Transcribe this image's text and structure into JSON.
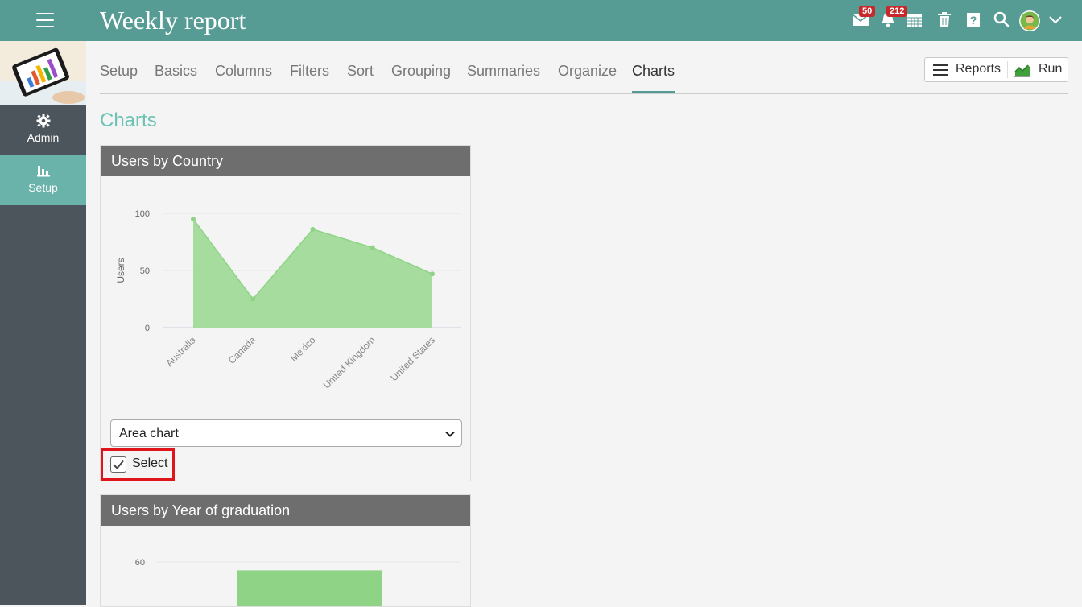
{
  "header": {
    "title": "Weekly report",
    "messages_badge": "50",
    "notifications_badge": "212"
  },
  "sidebar": {
    "items": [
      {
        "label": "Admin",
        "icon": "gear-icon"
      },
      {
        "label": "Setup",
        "icon": "bar-chart-icon"
      }
    ]
  },
  "tabs": [
    "Setup",
    "Basics",
    "Columns",
    "Filters",
    "Sort",
    "Grouping",
    "Summaries",
    "Organize",
    "Charts"
  ],
  "active_tab": "Charts",
  "actions": {
    "reports_label": "Reports",
    "run_label": "Run"
  },
  "section_title": "Charts",
  "panels": [
    {
      "title": "Users by Country",
      "chart_type_select": "Area chart",
      "select_label": "Select",
      "select_checked": true
    },
    {
      "title": "Users by Year of graduation"
    }
  ],
  "chart_data": [
    {
      "type": "area",
      "categories": [
        "Australia",
        "Canada",
        "Mexico",
        "United Kingdom",
        "United States"
      ],
      "values": [
        95,
        25,
        86,
        70,
        47
      ],
      "ylabel": "Users",
      "yticks": [
        "0",
        "50",
        "100"
      ],
      "ylim": [
        0,
        100
      ],
      "color": "#8fd486"
    },
    {
      "type": "bar",
      "categories": [
        ""
      ],
      "values": [
        56
      ],
      "yticks": [
        "60"
      ],
      "color": "#8fd486"
    }
  ]
}
